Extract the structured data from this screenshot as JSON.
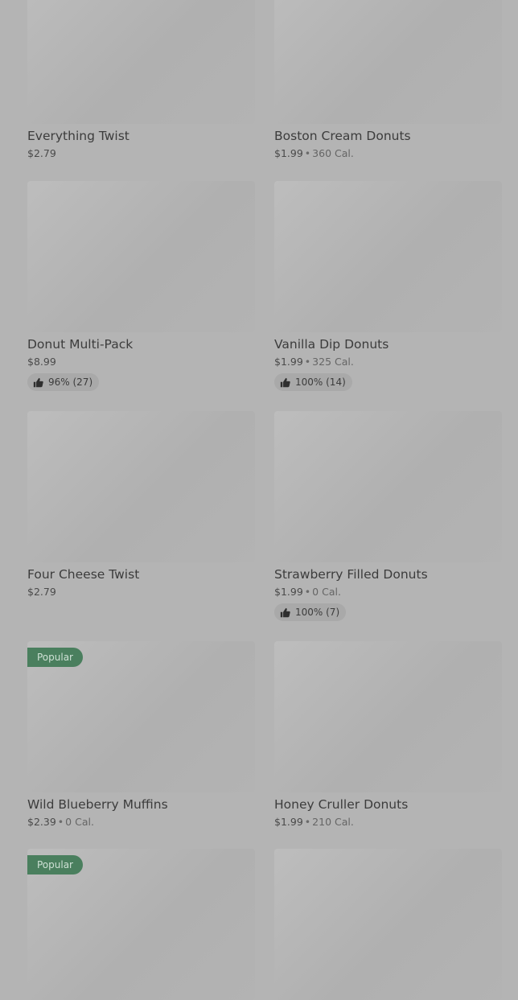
{
  "items": [
    {
      "name": "Everything Twist",
      "price": "$2.79",
      "cal": "",
      "rating": "",
      "badge": ""
    },
    {
      "name": "Boston Cream Donuts",
      "price": "$1.99",
      "cal": "360 Cal.",
      "rating": "",
      "badge": ""
    },
    {
      "name": "Donut Multi-Pack",
      "price": "$8.99",
      "cal": "",
      "rating": "96% (27)",
      "badge": ""
    },
    {
      "name": "Vanilla Dip Donuts",
      "price": "$1.99",
      "cal": "325 Cal.",
      "rating": "100% (14)",
      "badge": ""
    },
    {
      "name": "Four Cheese Twist",
      "price": "$2.79",
      "cal": "",
      "rating": "",
      "badge": ""
    },
    {
      "name": "Strawberry Filled Donuts",
      "price": "$1.99",
      "cal": "0 Cal.",
      "rating": "100% (7)",
      "badge": ""
    },
    {
      "name": "Wild Blueberry Muffins",
      "price": "$2.39",
      "cal": "0 Cal.",
      "rating": "",
      "badge": "Popular"
    },
    {
      "name": "Honey Cruller Donuts",
      "price": "$1.99",
      "cal": "210 Cal.",
      "rating": "",
      "badge": ""
    },
    {
      "name": "",
      "price": "",
      "cal": "",
      "rating": "",
      "badge": "Popular"
    },
    {
      "name": "",
      "price": "",
      "cal": "",
      "rating": "",
      "badge": ""
    }
  ],
  "separator": "•",
  "icons": {
    "rating": "thumbs-up-icon"
  },
  "colors": {
    "badge": "#4a7f5e",
    "overlay": "#b4b4b4"
  }
}
